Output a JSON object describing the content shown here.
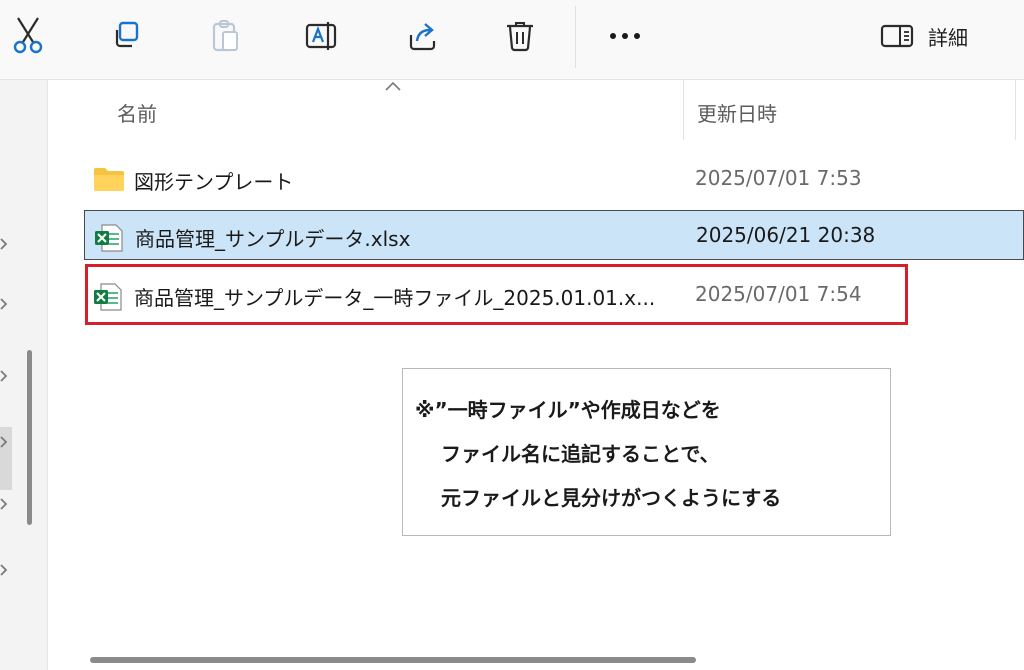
{
  "toolbar": {
    "details_label": "詳細",
    "buttons": [
      "cut-icon",
      "copy-icon",
      "paste-icon",
      "rename-icon",
      "share-icon",
      "delete-icon",
      "more-icon",
      "details-pane-icon"
    ]
  },
  "columns": {
    "name": "名前",
    "modified": "更新日時"
  },
  "files": [
    {
      "name": "図形テンプレート",
      "modified": "2025/07/01 7:53",
      "type": "folder"
    },
    {
      "name": "商品管理_サンプルデータ.xlsx",
      "modified": "2025/06/21 20:38",
      "type": "excel",
      "selected": true
    },
    {
      "name": "商品管理_サンプルデータ_一時ファイル_2025.01.01.x...",
      "modified": "2025/07/01 7:54",
      "type": "excel",
      "highlighted": true
    }
  ],
  "callout": {
    "line1": "※”一時ファイル”や作成日などを",
    "line2": "ファイル名に追記することで、",
    "line3": "元ファイルと見分けがつくようにする"
  },
  "colors": {
    "selection": "#cce4f7",
    "highlight_border": "#d81e2a",
    "accent": "#0067c0"
  }
}
